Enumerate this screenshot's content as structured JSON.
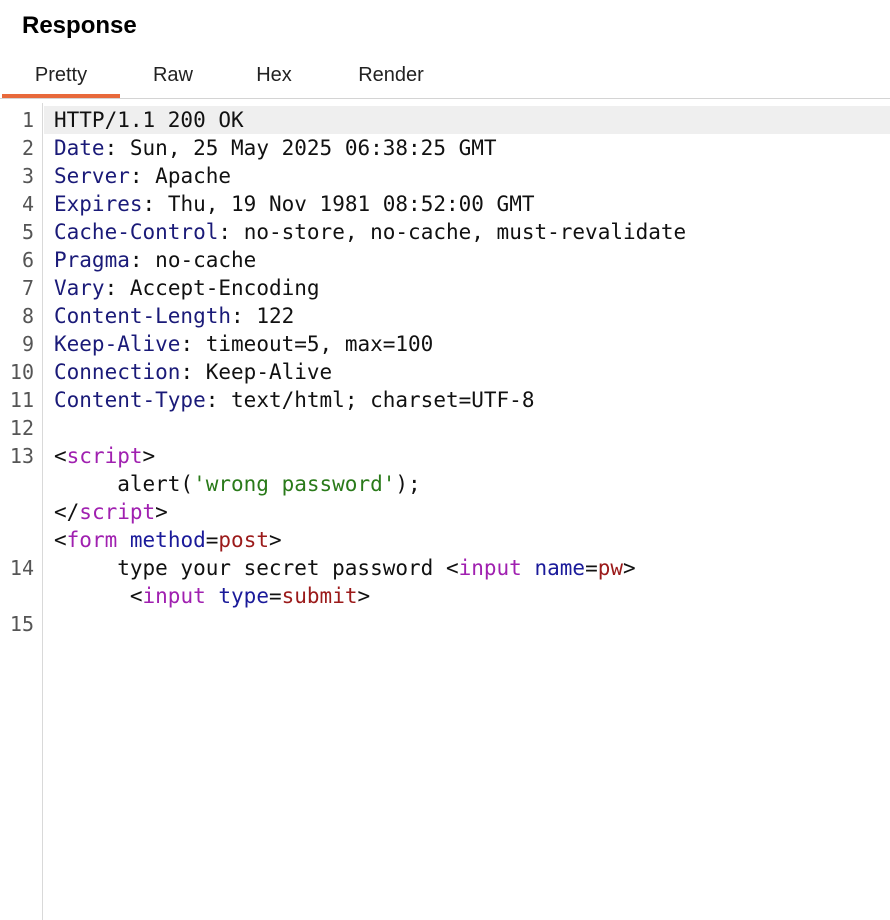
{
  "panel": {
    "title": "Response"
  },
  "tabs": [
    {
      "label": "Pretty",
      "active": true
    },
    {
      "label": "Raw",
      "active": false
    },
    {
      "label": "Hex",
      "active": false
    },
    {
      "label": "Render",
      "active": false
    }
  ],
  "gutter": {
    "l1": "1",
    "l2": "2",
    "l3": "3",
    "l4": "4",
    "l5": "5",
    "l6": "6",
    "l7": "7",
    "l8": "8",
    "l9": "9",
    "l10": "10",
    "l11": "11",
    "l12": "12",
    "l13": "13",
    "l14": "14",
    "l15": "15"
  },
  "response": {
    "status_line": "HTTP/1.1 200 OK",
    "headers": [
      {
        "name": "Date",
        "value": "Sun, 25 May 2025 06:38:25 GMT"
      },
      {
        "name": "Server",
        "value": "Apache"
      },
      {
        "name": "Expires",
        "value": "Thu, 19 Nov 1981 08:52:00 GMT"
      },
      {
        "name": "Cache-Control",
        "value": "no-store, no-cache, must-revalidate"
      },
      {
        "name": "Pragma",
        "value": "no-cache"
      },
      {
        "name": "Vary",
        "value": "Accept-Encoding"
      },
      {
        "name": "Content-Length",
        "value": "122"
      },
      {
        "name": "Keep-Alive",
        "value": "timeout=5, max=100"
      },
      {
        "name": "Connection",
        "value": "Keep-Alive"
      },
      {
        "name": "Content-Type",
        "value": "text/html; charset=UTF-8"
      }
    ],
    "separator": ":",
    "body": {
      "lt": "<",
      "gt": ">",
      "lt_slash": "</",
      "script_tag": "script",
      "alert_open": "alert(",
      "alert_string": "'wrong password'",
      "alert_close": ");",
      "form_tag": "form",
      "form_attr": "method",
      "eq": "=",
      "form_attr_value": "post",
      "prompt_text": "type your secret password ",
      "input_tag": "input",
      "input_attr_name": "name",
      "input_attr_name_value": "pw",
      "input_attr_type": "type",
      "input_attr_type_value": "submit"
    }
  }
}
